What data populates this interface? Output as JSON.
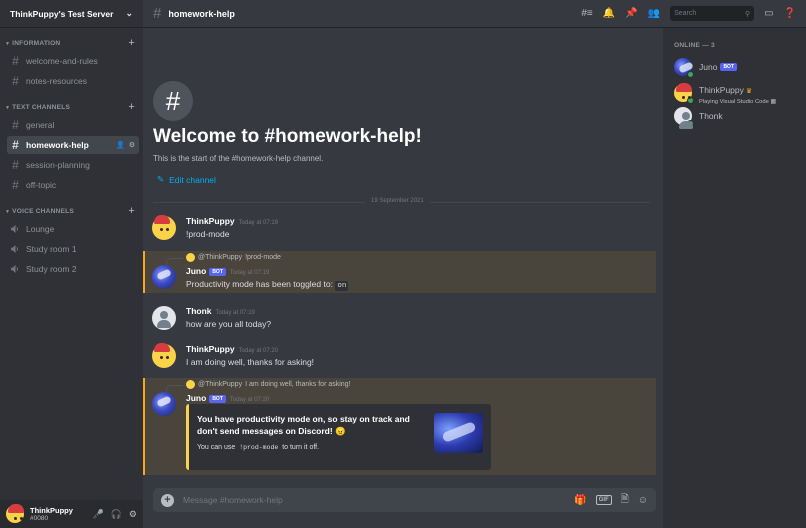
{
  "server": {
    "name": "ThinkPuppy's Test Server"
  },
  "categories": {
    "information": "INFORMATION",
    "text": "TEXT CHANNELS",
    "voice": "VOICE CHANNELS"
  },
  "info_channels": [
    "welcome-and-rules",
    "notes-resources"
  ],
  "text_channels": [
    "general",
    "homework-help",
    "session-planning",
    "off-topic"
  ],
  "voice_channels": [
    "Lounge",
    "Study room 1",
    "Study room 2"
  ],
  "user_panel": {
    "name": "ThinkPuppy",
    "tag": "#0080"
  },
  "header": {
    "channel": "homework-help",
    "search_placeholder": "Search"
  },
  "welcome": {
    "title": "Welcome to #homework-help!",
    "subtitle": "This is the start of the #homework-help channel.",
    "edit_label": "Edit channel"
  },
  "date_divider": "19 September 2021",
  "bot_badge": "BOT",
  "messages": [
    {
      "author": "ThinkPuppy",
      "time": "Today at 07:19",
      "text": "!prod-mode"
    },
    {
      "author": "Juno",
      "time": "Today at 07:19",
      "reply_to": "@ThinkPuppy",
      "reply_text": "!prod-mode",
      "text": "Productivity mode has been toggled to:",
      "code": "on"
    },
    {
      "author": "Thonk",
      "time": "Today at 07:19",
      "text": "how are you all today?"
    },
    {
      "author": "ThinkPuppy",
      "time": "Today at 07:20",
      "text": "I am doing well, thanks for asking!"
    },
    {
      "author": "Juno",
      "time": "Today at 07:20",
      "reply_to": "@ThinkPuppy",
      "reply_text": "I am doing well, thanks for asking!"
    }
  ],
  "embed": {
    "title": "You have productivity mode on, so stay on track and don't send messages on Discord! 😠",
    "desc_pre": "You can use",
    "desc_code": "!prod-mode",
    "desc_post": "to turn it off."
  },
  "composer": {
    "placeholder": "Message #homework-help",
    "gif": "GIF"
  },
  "members": {
    "header": "ONLINE — 3",
    "list": [
      {
        "name": "Juno",
        "badge": "BOT"
      },
      {
        "name": "ThinkPuppy",
        "status": "Playing Visual Studio Code"
      },
      {
        "name": "Thonk"
      }
    ]
  },
  "colors": {
    "accent": "#5865f2",
    "link": "#00aff4",
    "mention_highlight": "#49443c",
    "online": "#3ba55d"
  }
}
